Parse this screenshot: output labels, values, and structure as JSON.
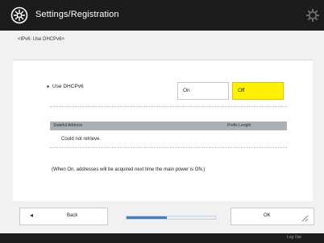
{
  "header": {
    "title": "Settings/Registration"
  },
  "breadcrumb": "<IPv6: Use DHCPv6>",
  "setting": {
    "label": "Use DHCPv6",
    "on_label": "On",
    "off_label": "Off",
    "selected": "Off"
  },
  "table": {
    "col_left": "Stateful Address",
    "col_right": "Prefix Length",
    "row_text": "Could not retrieve."
  },
  "note": "(When On, addresses will be acquired next time the main power is ON.)",
  "bottom": {
    "back_label": "Back",
    "ok_label": "OK",
    "progress_fraction": 0.45
  },
  "footer": {
    "logout_label": "Log Out"
  },
  "colors": {
    "header_bg": "#1c1c1c",
    "selected_option": "#fff200",
    "progress_fill": "#3f7fc7"
  }
}
